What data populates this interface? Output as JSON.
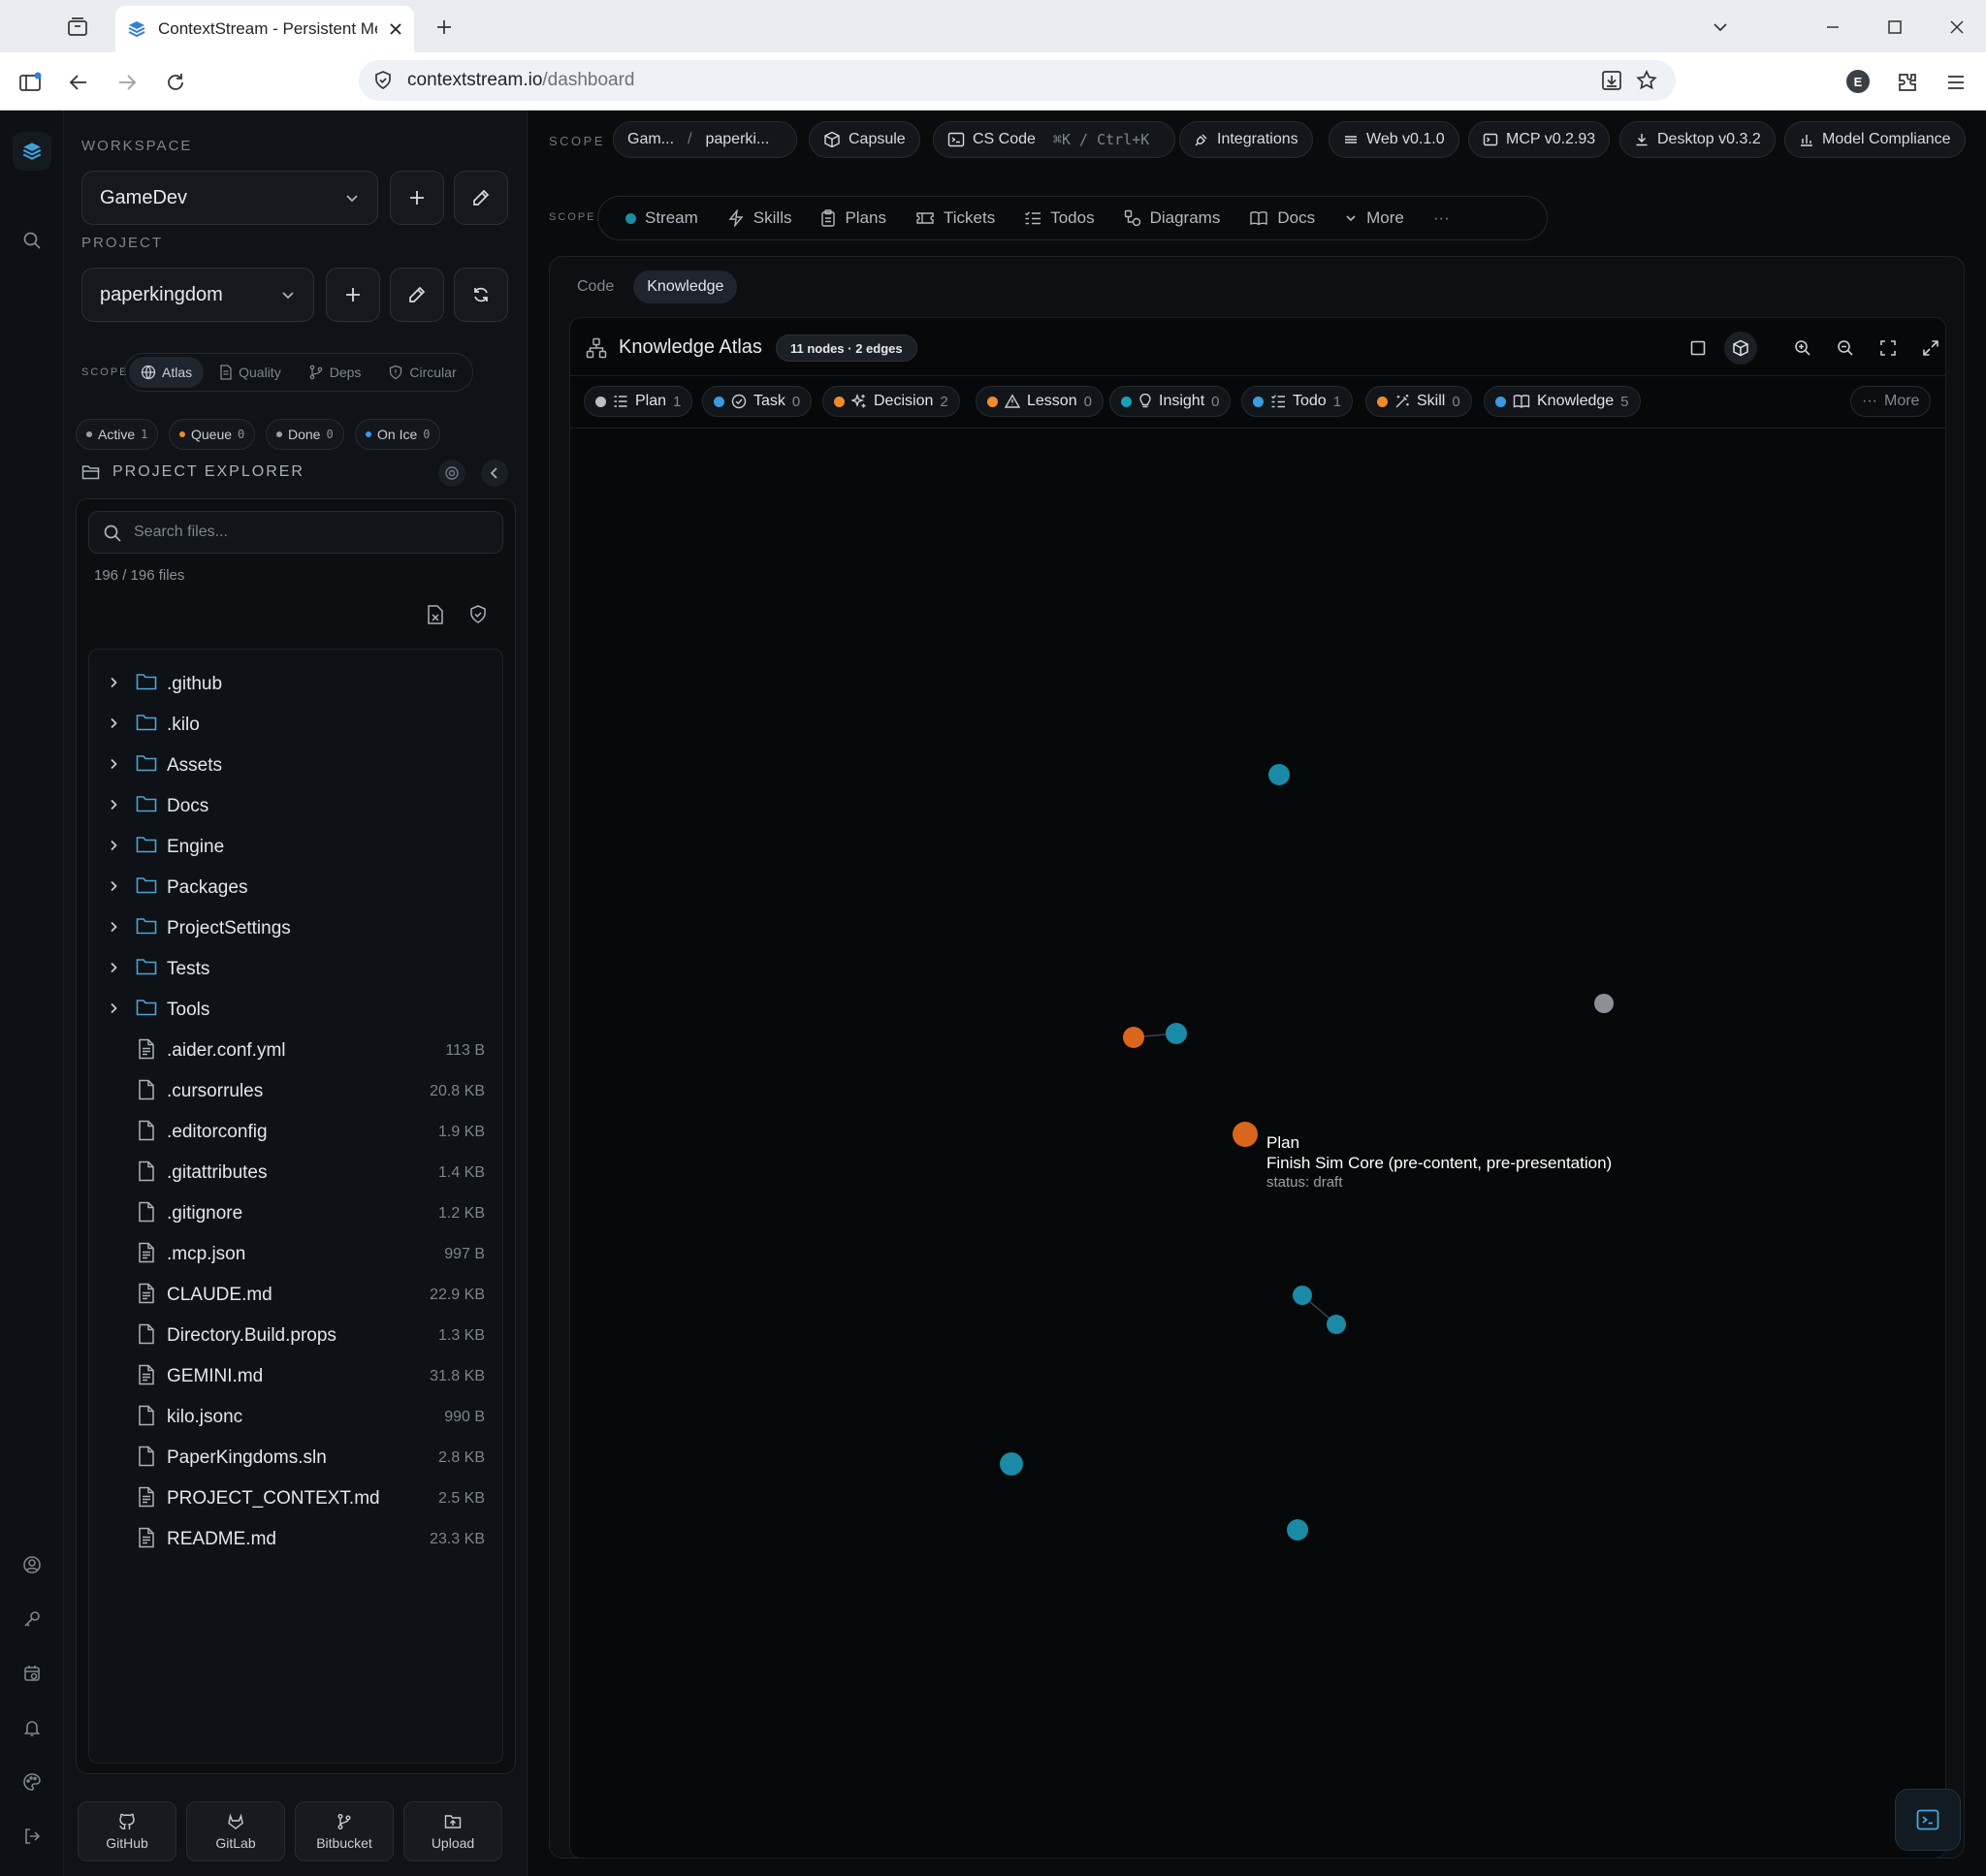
{
  "browser": {
    "tab_title": "ContextStream - Persistent Mem",
    "url_host": "contextstream.io",
    "url_path": "/dashboard",
    "profile_initial": "E"
  },
  "sidebar": {
    "workspace_label": "WORKSPACE",
    "workspace_value": "GameDev",
    "project_label": "PROJECT",
    "project_value": "paperkingdom",
    "scope_label": "SCOPE",
    "scope_tabs": [
      {
        "label": "Atlas",
        "icon": "globe-icon",
        "active": true
      },
      {
        "label": "Quality",
        "icon": "document-icon",
        "active": false
      },
      {
        "label": "Deps",
        "icon": "git-branch-icon",
        "active": false
      },
      {
        "label": "Circular",
        "icon": "shield-icon",
        "active": false
      }
    ],
    "status_chips": [
      {
        "label": "Active",
        "count": "1",
        "color": "#9aa1a9"
      },
      {
        "label": "Queue",
        "count": "0",
        "color": "#f08a2a"
      },
      {
        "label": "Done",
        "count": "0",
        "color": "#9aa1a9"
      },
      {
        "label": "On Ice",
        "count": "0",
        "color": "#3b9ae1"
      }
    ],
    "explorer_title": "PROJECT EXPLORER",
    "search_placeholder": "Search files...",
    "file_count": "196 / 196 files",
    "tree": [
      {
        "name": ".github",
        "type": "folder"
      },
      {
        "name": ".kilo",
        "type": "folder"
      },
      {
        "name": "Assets",
        "type": "folder"
      },
      {
        "name": "Docs",
        "type": "folder"
      },
      {
        "name": "Engine",
        "type": "folder"
      },
      {
        "name": "Packages",
        "type": "folder"
      },
      {
        "name": "ProjectSettings",
        "type": "folder"
      },
      {
        "name": "Tests",
        "type": "folder"
      },
      {
        "name": "Tools",
        "type": "folder"
      },
      {
        "name": ".aider.conf.yml",
        "type": "text-file",
        "size": "113 B"
      },
      {
        "name": ".cursorrules",
        "type": "file",
        "size": "20.8 KB"
      },
      {
        "name": ".editorconfig",
        "type": "file",
        "size": "1.9 KB"
      },
      {
        "name": ".gitattributes",
        "type": "file",
        "size": "1.4 KB"
      },
      {
        "name": ".gitignore",
        "type": "file",
        "size": "1.2 KB"
      },
      {
        "name": ".mcp.json",
        "type": "text-file",
        "size": "997 B"
      },
      {
        "name": "CLAUDE.md",
        "type": "text-file",
        "size": "22.9 KB"
      },
      {
        "name": "Directory.Build.props",
        "type": "file",
        "size": "1.3 KB"
      },
      {
        "name": "GEMINI.md",
        "type": "text-file",
        "size": "31.8 KB"
      },
      {
        "name": "kilo.jsonc",
        "type": "file",
        "size": "990 B"
      },
      {
        "name": "PaperKingdoms.sln",
        "type": "file",
        "size": "2.8 KB"
      },
      {
        "name": "PROJECT_CONTEXT.md",
        "type": "text-file",
        "size": "2.5 KB"
      },
      {
        "name": "README.md",
        "type": "text-file",
        "size": "23.3 KB"
      }
    ],
    "vcs_buttons": [
      {
        "label": "GitHub",
        "icon": "github-icon"
      },
      {
        "label": "GitLab",
        "icon": "gitlab-icon"
      },
      {
        "label": "Bitbucket",
        "icon": "bitbucket-icon"
      },
      {
        "label": "Upload",
        "icon": "upload-icon"
      }
    ]
  },
  "topbar": {
    "scope_label": "SCOPE",
    "breadcrumb_workspace": "Gam...",
    "breadcrumb_sep": "/",
    "breadcrumb_project": "paperki...",
    "capsule": "Capsule",
    "cs_code": "CS Code",
    "shortcut": "⌘K / Ctrl+K",
    "integrations": "Integrations",
    "web_version": "Web v0.1.0",
    "mcp_version": "MCP v0.2.93",
    "desktop_version": "Desktop v0.3.2",
    "model_compliance": "Model Compliance"
  },
  "nav": {
    "scope_label": "SCOPE",
    "items": [
      {
        "label": "Stream",
        "icon": "dot-icon"
      },
      {
        "label": "Skills",
        "icon": "bolt-icon"
      },
      {
        "label": "Plans",
        "icon": "clipboard-icon"
      },
      {
        "label": "Tickets",
        "icon": "ticket-icon"
      },
      {
        "label": "Todos",
        "icon": "checklist-icon"
      },
      {
        "label": "Diagrams",
        "icon": "diagram-icon"
      },
      {
        "label": "Docs",
        "icon": "book-icon"
      },
      {
        "label": "More",
        "icon": "chevron-down-icon"
      }
    ],
    "overflow": "···"
  },
  "content": {
    "sub_tabs": [
      {
        "label": "Code",
        "active": false
      },
      {
        "label": "Knowledge",
        "active": true
      }
    ],
    "atlas_title": "Knowledge Atlas",
    "atlas_badge": "11 nodes · 2 edges",
    "filters": [
      {
        "label": "Plan",
        "count": "1",
        "color": "#b9bec5",
        "icon": "list-icon"
      },
      {
        "label": "Task",
        "count": "0",
        "color": "#3b9ae1",
        "icon": "check-circle-icon"
      },
      {
        "label": "Decision",
        "count": "2",
        "color": "#f08a2a",
        "icon": "sparkles-icon"
      },
      {
        "label": "Lesson",
        "count": "0",
        "color": "#f08a2a",
        "icon": "warning-icon"
      },
      {
        "label": "Insight",
        "count": "0",
        "color": "#1aa0b8",
        "icon": "lightbulb-icon"
      },
      {
        "label": "Todo",
        "count": "1",
        "color": "#3b9ae1",
        "icon": "checklist-icon"
      },
      {
        "label": "Skill",
        "count": "0",
        "color": "#f08a2a",
        "icon": "wand-icon"
      },
      {
        "label": "Knowledge",
        "count": "5",
        "color": "#3b9ae1",
        "icon": "book-icon"
      }
    ],
    "filters_more": "More",
    "tooltip": {
      "type": "Plan",
      "title": "Finish Sim Core (pre-content, pre-presentation)",
      "status": "status: draft"
    },
    "colors": {
      "teal_node": "#1a8aa6",
      "orange_node": "#d9661c",
      "gray_node": "#8b8f96"
    }
  }
}
